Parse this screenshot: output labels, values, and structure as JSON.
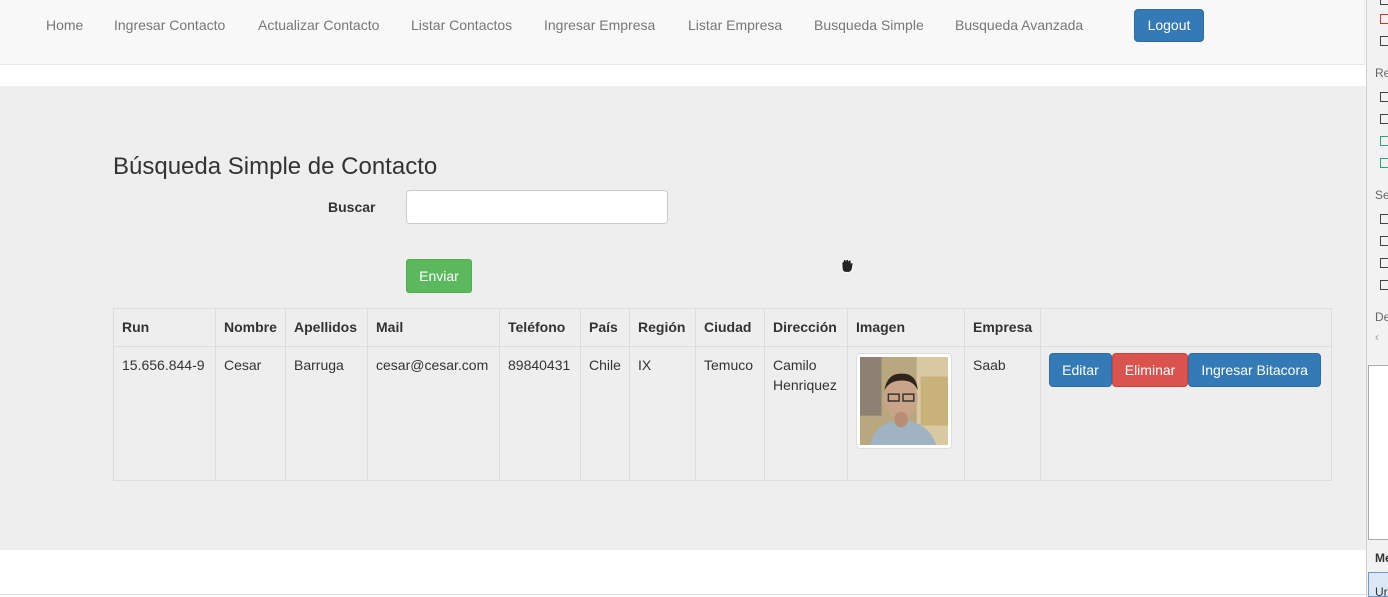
{
  "nav": {
    "items": [
      "Home",
      "Ingresar Contacto",
      "Actualizar Contacto",
      "Listar Contactos",
      "Ingresar Empresa",
      "Listar Empresa",
      "Busqueda Simple",
      "Busqueda Avanzada"
    ],
    "logout": "Logout"
  },
  "page": {
    "title": "Búsqueda Simple de Contacto",
    "search_label": "Buscar",
    "search_value": "",
    "submit_label": "Enviar"
  },
  "table": {
    "headers": [
      "Run",
      "Nombre",
      "Apellidos",
      "Mail",
      "Teléfono",
      "País",
      "Región",
      "Ciudad",
      "Dirección",
      "Imagen",
      "Empresa",
      ""
    ],
    "rows": [
      {
        "run": "15.656.844-9",
        "nombre": "Cesar",
        "apellidos": "Barruga",
        "mail": "cesar@cesar.com",
        "telefono": "89840431",
        "pais": "Chile",
        "region": "IX",
        "ciudad": "Temuco",
        "direccion": "Camilo Henriquez",
        "empresa": "Saab",
        "actions": {
          "edit": "Editar",
          "delete": "Eliminar",
          "log": "Ingresar Bitacora"
        }
      }
    ]
  },
  "side_panel": {
    "labels": [
      "Re",
      "Se",
      "De",
      "Me",
      "Ur"
    ]
  },
  "colors": {
    "primary": "#337ab7",
    "success": "#5cb85c",
    "danger": "#d9534f",
    "jumbotron": "#eeeeee"
  }
}
